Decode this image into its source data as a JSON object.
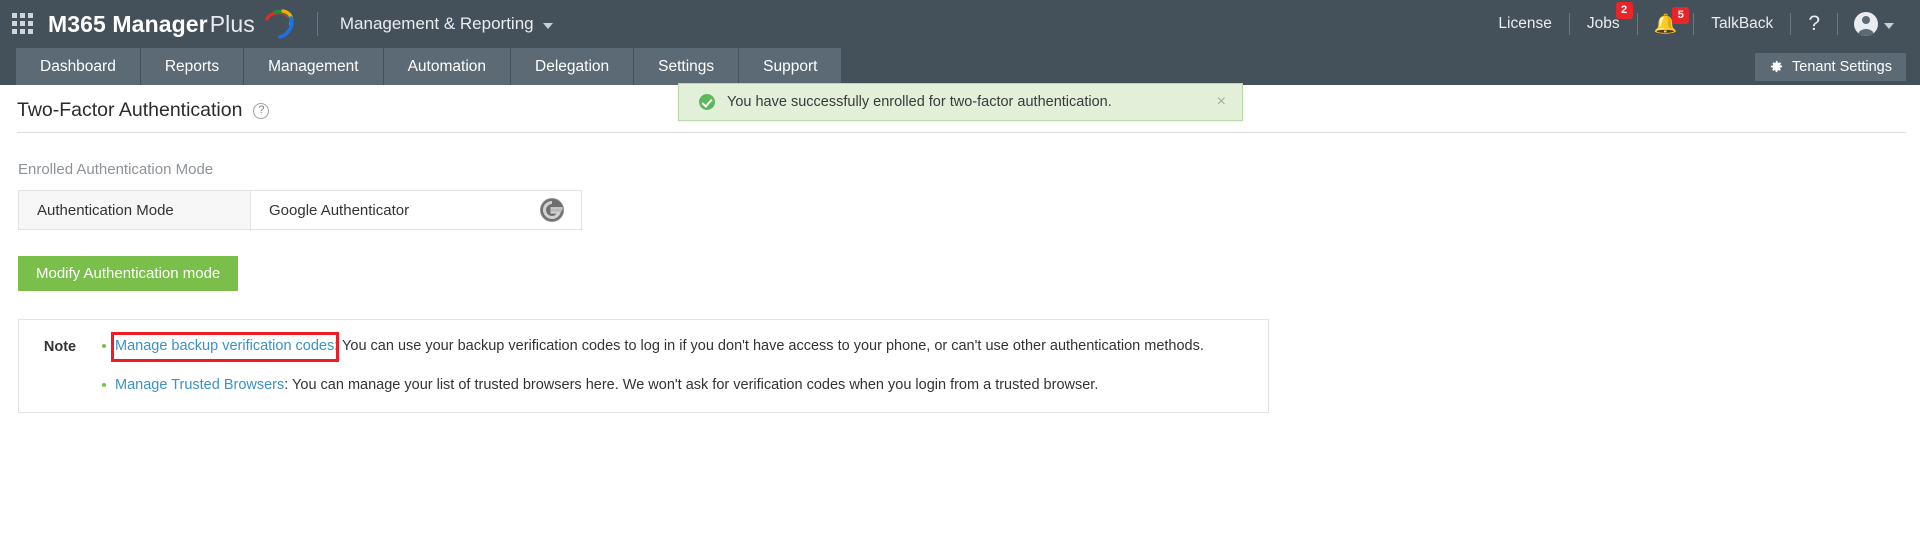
{
  "topbar": {
    "apps_icon": "grid-apps-icon",
    "brand_strong": "M365 Manager",
    "brand_light": "Plus",
    "module_label": "Management & Reporting",
    "module_caret": "chevron-down-icon",
    "right_items": [
      {
        "label": "License",
        "badge": ""
      },
      {
        "label": "Jobs",
        "badge": "2"
      }
    ],
    "notifications": {
      "icon": "bell-icon",
      "badge": "5"
    },
    "talkback_label": "TalkBack",
    "help_label": "?",
    "avatar": "user-avatar-icon"
  },
  "nav": {
    "tabs": [
      {
        "label": "Dashboard",
        "active": false
      },
      {
        "label": "Reports",
        "active": false
      },
      {
        "label": "Management",
        "active": false
      },
      {
        "label": "Automation",
        "active": false
      },
      {
        "label": "Delegation",
        "active": false
      },
      {
        "label": "Settings",
        "active": true
      },
      {
        "label": "Support",
        "active": false
      }
    ],
    "tenant_settings_label": "Tenant Settings"
  },
  "page": {
    "title": "Two-Factor Authentication",
    "help_glyph": "?"
  },
  "toast": {
    "message": "You have successfully enrolled for two-factor authentication.",
    "close_glyph": "×",
    "bg_color": "#e2f0d9",
    "accent_color": "#5cb85c"
  },
  "enrolled": {
    "section_label": "Enrolled Authentication Mode",
    "key": "Authentication Mode",
    "value": "Google Authenticator",
    "value_icon": "google-authenticator-icon"
  },
  "actions": {
    "modify_label": "Modify Authentication mode",
    "modify_color": "#79bf4a"
  },
  "note": {
    "label": "Note",
    "items": [
      {
        "link": "Manage backup verification codes",
        "separator": ": ",
        "text": "You can use your backup verification codes to log in if you don't have access to your phone, or can't use other authentication methods.",
        "highlighted": true
      },
      {
        "link": "Manage Trusted Browsers",
        "separator": ": ",
        "text": "You can manage your list of trusted browsers here. We won't ask for verification codes when you login from a trusted browser.",
        "highlighted": false
      }
    ],
    "highlight_color": "#ee1c25",
    "link_color": "#3b91c9"
  }
}
